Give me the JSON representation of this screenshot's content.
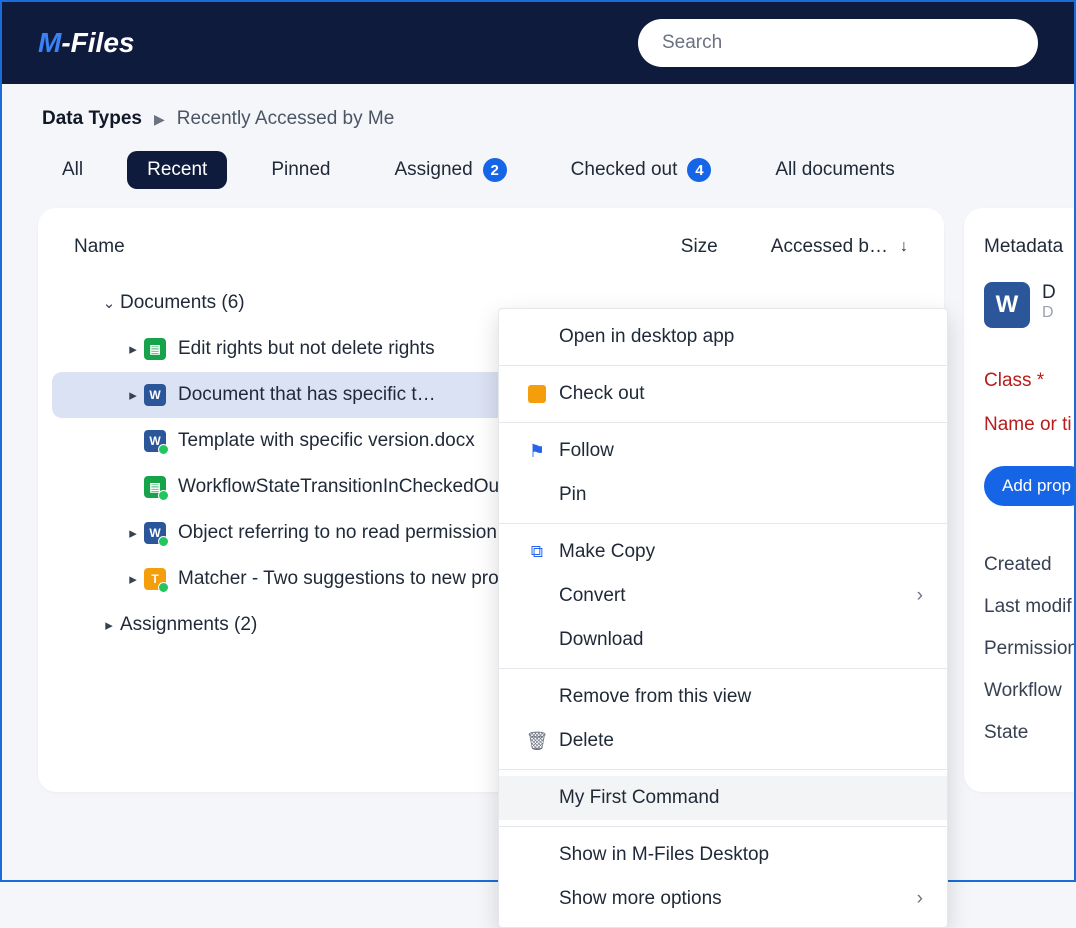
{
  "logo": {
    "first": "M",
    "rest": "-Files"
  },
  "search": {
    "placeholder": "Search"
  },
  "breadcrumb": {
    "root": "Data Types",
    "leaf": "Recently Accessed by Me"
  },
  "tabs": [
    {
      "label": "All"
    },
    {
      "label": "Recent",
      "active": true
    },
    {
      "label": "Pinned"
    },
    {
      "label": "Assigned",
      "badge": "2"
    },
    {
      "label": "Checked out",
      "badge": "4"
    },
    {
      "label": "All documents"
    }
  ],
  "columns": {
    "name": "Name",
    "size": "Size",
    "accessed": "Accessed b…"
  },
  "tree": {
    "documents_label": "Documents (6)",
    "items": [
      {
        "label": "Edit rights but not delete rights"
      },
      {
        "label": "Document that has specific t…",
        "selected": true
      },
      {
        "label": "Template with specific version.docx"
      },
      {
        "label": "WorkflowStateTransitionInCheckedOutObj…"
      },
      {
        "label": "Object referring to no read permission d…"
      },
      {
        "label": "Matcher - Two suggestions to new proper.."
      }
    ],
    "assignments_label": "Assignments (2)"
  },
  "context_menu": {
    "open": "Open in desktop app",
    "checkout": "Check out",
    "follow": "Follow",
    "pin": "Pin",
    "copy": "Make Copy",
    "convert": "Convert",
    "download": "Download",
    "remove": "Remove from this view",
    "delete": "Delete",
    "custom": "My First Command",
    "desktop": "Show in M-Files Desktop",
    "more": "Show more options"
  },
  "side": {
    "title": "Metadata",
    "doc_initial": "W",
    "d1": "D",
    "d2": "D",
    "class": "Class *",
    "name": "Name or ti",
    "add": "Add prop",
    "created": "Created",
    "modified": "Last modif",
    "permissions": "Permission",
    "workflow": "Workflow",
    "state": "State"
  }
}
